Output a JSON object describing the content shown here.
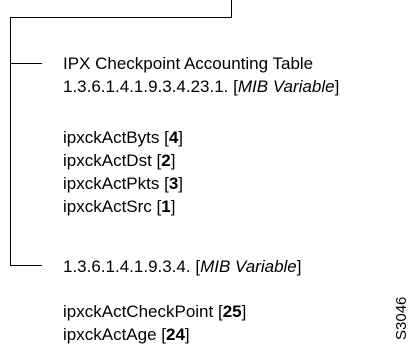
{
  "diagram": {
    "node1": {
      "title": "IPX Checkpoint Accounting Table",
      "oid": "1.3.6.1.4.1.9.3.4.23.1.",
      "oid_tag": "MIB Variable",
      "variables": [
        {
          "name": "ipxckActByts",
          "index": "4"
        },
        {
          "name": "ipxckActDst",
          "index": "2"
        },
        {
          "name": "ipxckActPkts",
          "index": "3"
        },
        {
          "name": "ipxckActSrc",
          "index": "1"
        }
      ]
    },
    "node2": {
      "oid": "1.3.6.1.4.1.9.3.4.",
      "oid_tag": "MIB Variable",
      "variables": [
        {
          "name": "ipxckActCheckPoint",
          "index": "25"
        },
        {
          "name": "ipxckActAge",
          "index": "24"
        }
      ]
    },
    "figure_code": "S3046"
  }
}
